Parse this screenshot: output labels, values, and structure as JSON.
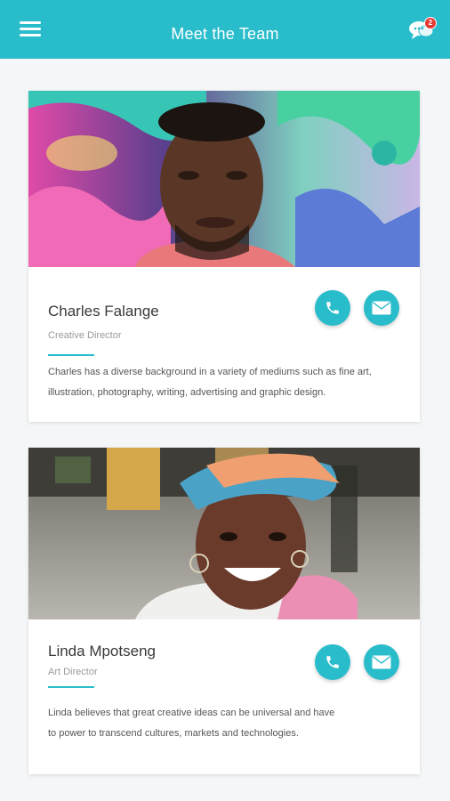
{
  "header": {
    "title": "Meet the Team",
    "menu_icon": "hamburger-menu-icon",
    "chat_icon": "chat-bubbles-icon",
    "chat_badge": "2"
  },
  "colors": {
    "accent": "#29bccb",
    "badge": "#e53935",
    "background": "#f4f6f7"
  },
  "team": [
    {
      "name": "Charles Falange",
      "role": "Creative Director",
      "bio": "Charles has a diverse background in a variety of mediums such as fine art, illustration, photography, writing, advertising and graphic design.",
      "actions": [
        "phone-icon",
        "mail-icon"
      ]
    },
    {
      "name": "Linda Mpotseng",
      "role": "Art Director",
      "bio": "Linda believes that great creative ideas can be universal and have to power to transcend cultures, markets and technologies.",
      "actions": [
        "phone-icon",
        "mail-icon"
      ]
    }
  ]
}
